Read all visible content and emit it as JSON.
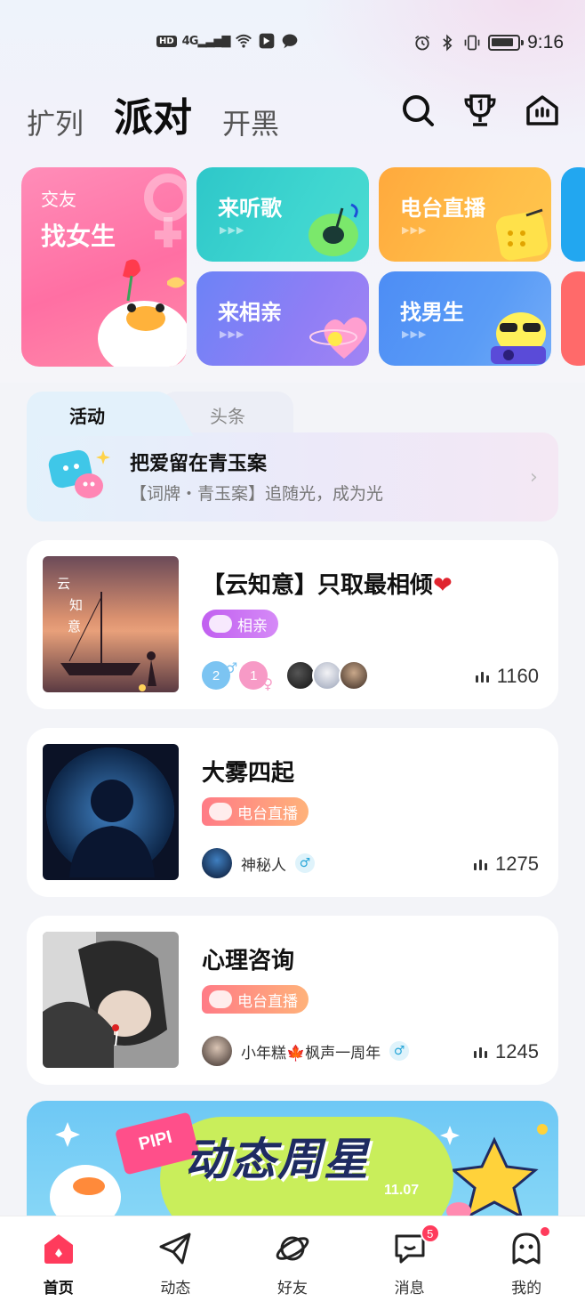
{
  "status_bar": {
    "network": "HD",
    "signal": "4G",
    "time": "9:16"
  },
  "header": {
    "tabs": [
      {
        "label": "扩列"
      },
      {
        "label": "派对"
      },
      {
        "label": "开黑"
      }
    ],
    "icons": [
      "search-icon",
      "trophy-icon",
      "home-icon"
    ]
  },
  "categories": {
    "big": {
      "subtitle": "交友",
      "title": "找女生"
    },
    "cards": [
      {
        "title": "来听歌"
      },
      {
        "title": "电台直播"
      },
      {
        "title": "来相亲"
      },
      {
        "title": "找男生"
      }
    ],
    "arrows": "▶▶▶"
  },
  "activity": {
    "tabs": [
      {
        "label": "活动"
      },
      {
        "label": "头条"
      }
    ],
    "title": "把爱留在青玉案",
    "description": "【词牌・青玉案】追随光，成为光"
  },
  "rooms": [
    {
      "title": "【云知意】只取最相倾",
      "tag": "相亲",
      "male_count": "2",
      "female_count": "1",
      "listeners": "1160"
    },
    {
      "title": "大雾四起",
      "tag": "电台直播",
      "host": "神秘人",
      "host_gender": "♂",
      "listeners": "1275"
    },
    {
      "title": "心理咨询",
      "tag": "电台直播",
      "host": "小年糕🍁枫声一周年",
      "host_gender": "♂",
      "listeners": "1245"
    }
  ],
  "banner": {
    "flag": "PIPI",
    "title": "动态周星",
    "date": "11.07"
  },
  "bottom_nav": [
    {
      "label": "首页",
      "icon": "home-icon"
    },
    {
      "label": "动态",
      "icon": "paper-plane-icon"
    },
    {
      "label": "好友",
      "icon": "planet-icon"
    },
    {
      "label": "消息",
      "icon": "message-icon",
      "badge": "5"
    },
    {
      "label": "我的",
      "icon": "ghost-icon"
    }
  ],
  "colors": {
    "accent": "#ff3b5c",
    "dating_tag": "#c15ff0",
    "radio_tag": "#ff7b86"
  }
}
